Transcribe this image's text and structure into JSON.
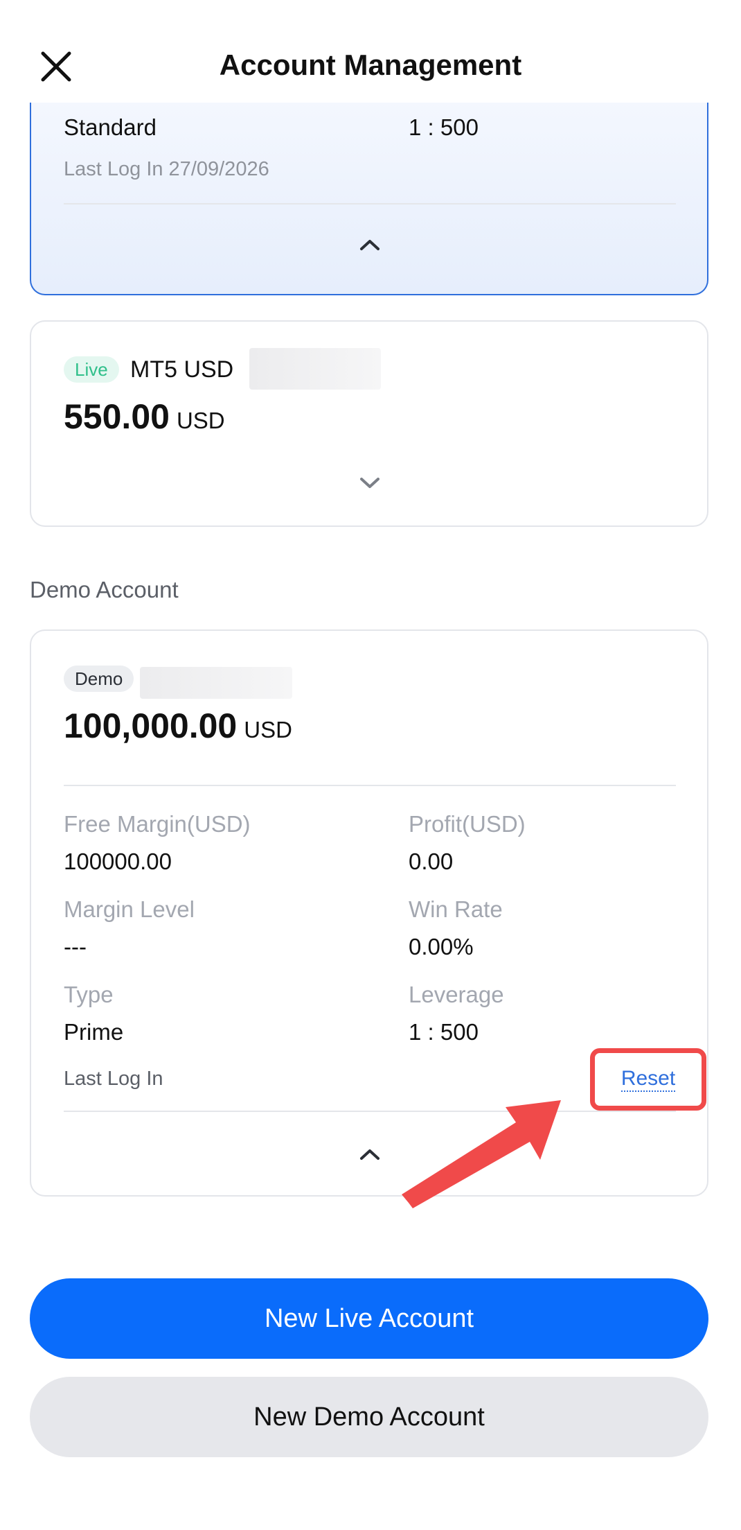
{
  "header": {
    "title": "Account Management"
  },
  "card_live_expanded": {
    "type_value": "Standard",
    "leverage_value": "1 : 500",
    "last_login": "Last Log In 27/09/2026"
  },
  "card_live_collapsed": {
    "badge": "Live",
    "account_name": "MT5 USD",
    "balance": "550.00",
    "currency": "USD"
  },
  "demo_section": {
    "label": "Demo Account"
  },
  "card_demo": {
    "badge": "Demo",
    "balance": "100,000.00",
    "currency": "USD",
    "free_margin_label": "Free Margin(USD)",
    "free_margin_value": "100000.00",
    "profit_label": "Profit(USD)",
    "profit_value": "0.00",
    "margin_level_label": "Margin Level",
    "margin_level_value": "---",
    "win_rate_label": "Win Rate",
    "win_rate_value": "0.00%",
    "type_label": "Type",
    "type_value": "Prime",
    "leverage_label": "Leverage",
    "leverage_value": "1 : 500",
    "last_login": "Last Log In",
    "reset_label": "Reset"
  },
  "buttons": {
    "new_live": "New Live Account",
    "new_demo": "New Demo Account"
  },
  "colors": {
    "primary": "#0a6cfb",
    "highlight": "#f04a4a",
    "live_badge": "#2fbf8a",
    "link": "#2f6fdc"
  },
  "icons": {
    "close": "close-icon",
    "chevron_up": "chevron-up-icon",
    "chevron_down": "chevron-down-icon",
    "arrow": "pointer-arrow-icon"
  }
}
